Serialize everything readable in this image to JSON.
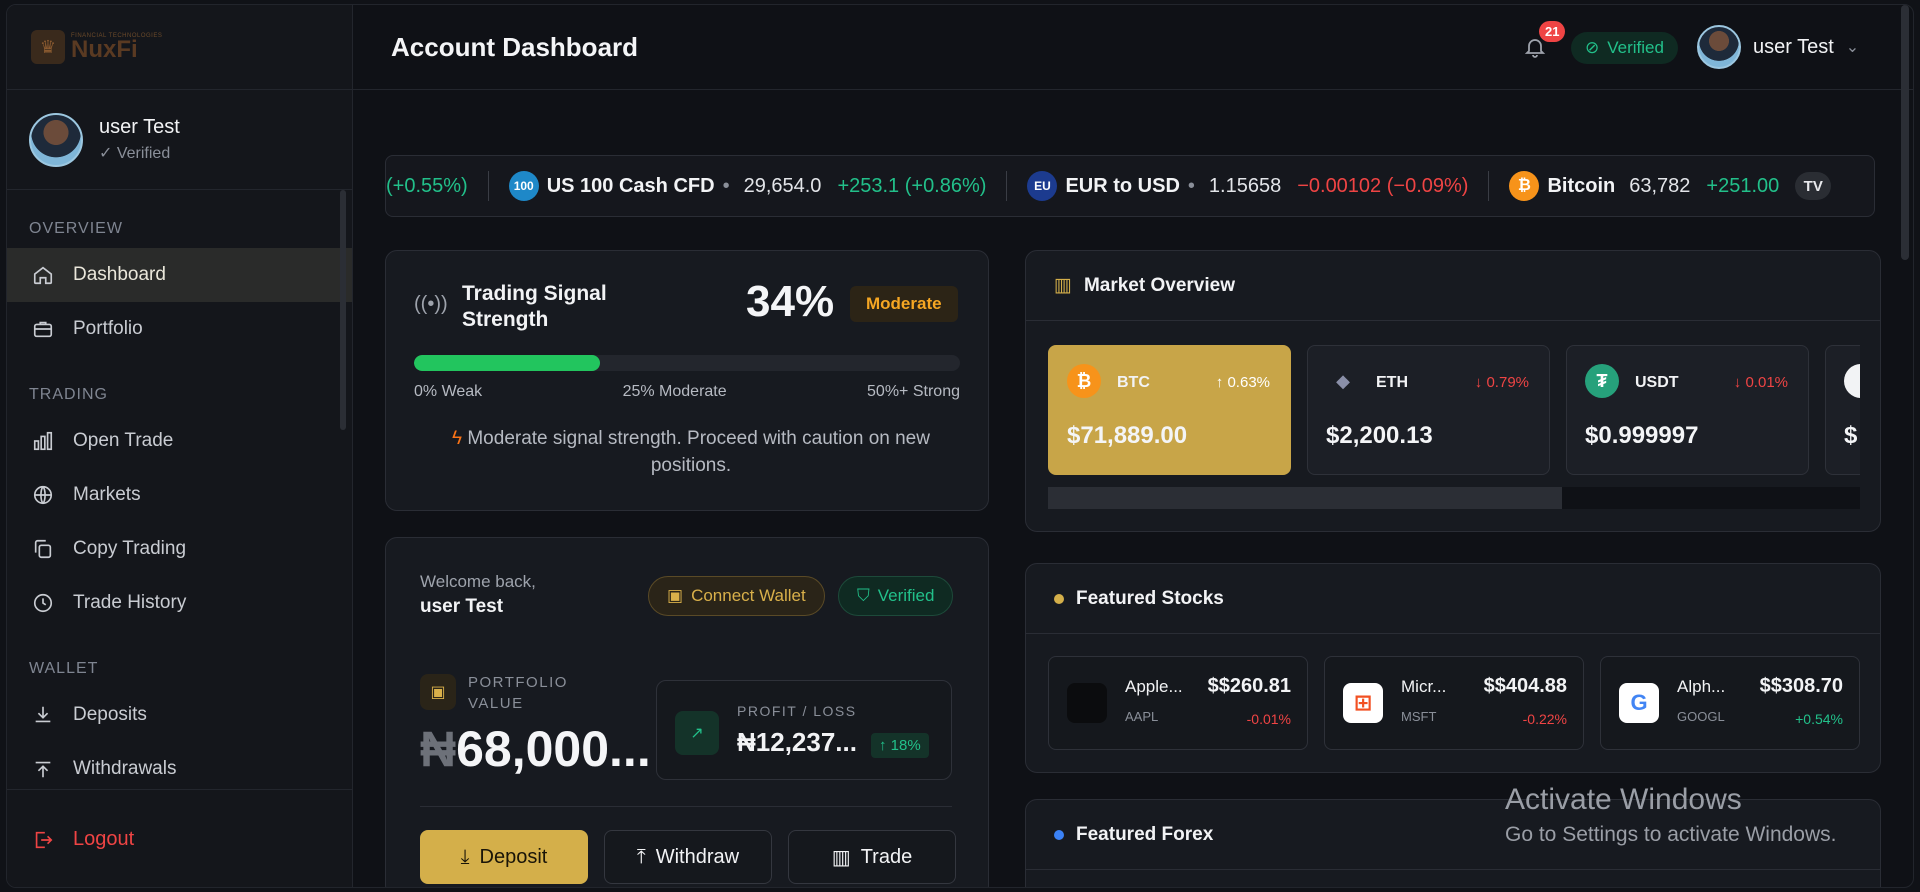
{
  "brand": {
    "name": "NuxFi",
    "tagline": "FINANCIAL TECHNOLOGIES"
  },
  "header": {
    "title": "Account Dashboard",
    "notifications_count": "21",
    "verified_label": "Verified",
    "user_name": "user Test"
  },
  "sidebar": {
    "profile": {
      "name": "user Test",
      "status": "✓ Verified"
    },
    "sections": {
      "overview": "OVERVIEW",
      "trading": "TRADING",
      "wallet": "WALLET"
    },
    "items": {
      "dashboard": "Dashboard",
      "portfolio": "Portfolio",
      "open_trade": "Open Trade",
      "markets": "Markets",
      "copy_trading": "Copy Trading",
      "trade_history": "Trade History",
      "deposits": "Deposits",
      "withdrawals": "Withdrawals"
    },
    "logout": "Logout"
  },
  "ticker": {
    "lead_change": "(+0.55%)",
    "items": [
      {
        "icon": "100",
        "name": "US 100 Cash CFD",
        "price": "29,654.0",
        "change": "+253.1 (+0.86%)",
        "direction": "up"
      },
      {
        "icon": "EU",
        "name": "EUR to USD",
        "price": "1.15658",
        "change": "−0.00102 (−0.09%)",
        "direction": "down"
      },
      {
        "icon": "₿",
        "name": "Bitcoin",
        "price": "63,782",
        "change": "+251.00",
        "direction": "up"
      }
    ],
    "badge": "TV"
  },
  "signal": {
    "title_line1": "Trading Signal",
    "title_line2": "Strength",
    "percent": "34%",
    "level": 0.34,
    "badge": "Moderate",
    "scale_weak": "0% Weak",
    "scale_moderate": "25% Moderate",
    "scale_strong": "50%+ Strong",
    "message": "Moderate signal strength. Proceed with caution on new positions."
  },
  "welcome": {
    "greeting": "Welcome back,",
    "name": "user Test",
    "connect_wallet": "Connect Wallet",
    "verified": "Verified",
    "portfolio_label": "PORTFOLIO VALUE",
    "portfolio_currency": "₦",
    "portfolio_value": "68,000...",
    "pl_label": "PROFIT / LOSS",
    "pl_value": "₦12,237...",
    "pl_change": "↑ 18%",
    "deposit": "Deposit",
    "withdraw": "Withdraw",
    "trade": "Trade"
  },
  "market": {
    "title": "Market Overview",
    "coins": [
      {
        "symbol": "BTC",
        "change": "↑ 0.63%",
        "price": "$71,889.00",
        "direction": "up",
        "icon": "₿",
        "color": "#f7931a"
      },
      {
        "symbol": "ETH",
        "change": "↓ 0.79%",
        "price": "$2,200.13",
        "direction": "down",
        "icon": "◆",
        "color": "#3a3d45"
      },
      {
        "symbol": "USDT",
        "change": "↓ 0.01%",
        "price": "$0.999997",
        "direction": "down",
        "icon": "₮",
        "color": "#26a17b"
      },
      {
        "symbol": "",
        "change": "",
        "price": "$",
        "direction": "up",
        "icon": "",
        "color": "#f2f3f5"
      }
    ]
  },
  "stocks": {
    "title": "Featured Stocks",
    "items": [
      {
        "name": "Apple...",
        "symbol": "AAPL",
        "price": "$$260.81",
        "change": "-0.01%",
        "direction": "down",
        "logo": ""
      },
      {
        "name": "Micr...",
        "symbol": "MSFT",
        "price": "$$404.88",
        "change": "-0.22%",
        "direction": "down",
        "logo": "⊞"
      },
      {
        "name": "Alph...",
        "symbol": "GOOGL",
        "price": "$$308.70",
        "change": "+0.54%",
        "direction": "up",
        "logo": "G"
      }
    ]
  },
  "forex": {
    "title": "Featured Forex"
  },
  "watermark": {
    "line1": "Activate Windows",
    "line2": "Go to Settings to activate Windows."
  },
  "colors": {
    "accent": "#d4af4a",
    "up": "#22c08a",
    "down": "#ef4444",
    "signal": "#22c55e"
  }
}
